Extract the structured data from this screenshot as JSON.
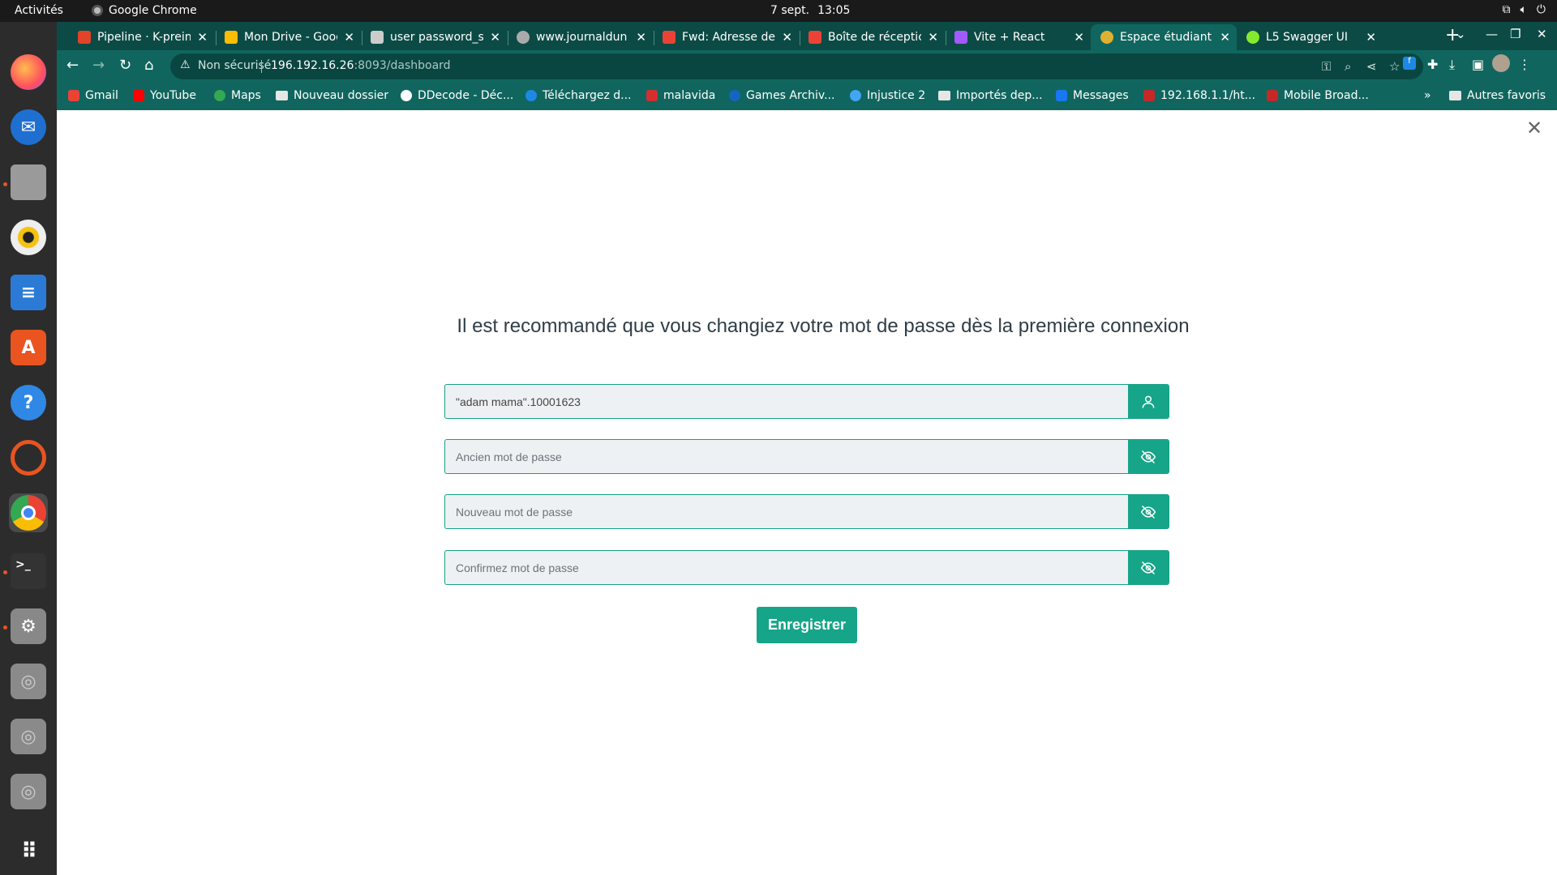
{
  "system": {
    "activities": "Activités",
    "app_name": "Google Chrome",
    "date": "7 sept.",
    "time": "13:05"
  },
  "tabs": [
    {
      "title": "Pipeline · K-prein",
      "icon": "gitlab-icon",
      "color": "#e24329"
    },
    {
      "title": "Mon Drive - Goog",
      "icon": "drive-icon",
      "color": "#fbbc04"
    },
    {
      "title": "user password_s",
      "icon": "doc-icon",
      "color": "#cccccc"
    },
    {
      "title": "www.journaldun",
      "icon": "globe-icon",
      "color": "#aaaaaa"
    },
    {
      "title": "Fwd: Adresse de",
      "icon": "gmail-icon",
      "color": "#ea4335"
    },
    {
      "title": "Boîte de réceptic",
      "icon": "gmail-icon",
      "color": "#ea4335"
    },
    {
      "title": "Vite + React",
      "icon": "vite-icon",
      "color": "#a259ff"
    },
    {
      "title": "Espace étudiant",
      "icon": "school-icon",
      "color": "#e0b030"
    },
    {
      "title": "L5 Swagger UI",
      "icon": "swagger-icon",
      "color": "#85ea2d"
    }
  ],
  "address": {
    "security": "Non sécurisé",
    "host": "196.192.16.26",
    "path": ":8093/dashboard"
  },
  "bookmarks": [
    {
      "label": "Gmail",
      "color": "#ea4335"
    },
    {
      "label": "YouTube",
      "color": "#ff0000"
    },
    {
      "label": "Maps",
      "color": "#34a853"
    },
    {
      "label": "Nouveau dossier",
      "color": "folder"
    },
    {
      "label": "DDecode - Déc...",
      "color": "#ffffff"
    },
    {
      "label": "Téléchargez d...",
      "color": "#1e88e5"
    },
    {
      "label": "malavida",
      "color": "#d32f2f"
    },
    {
      "label": "Games Archiv...",
      "color": "#1565c0"
    },
    {
      "label": "Injustice 2",
      "color": "#42a5f5"
    },
    {
      "label": "Importés dep...",
      "color": "folder"
    },
    {
      "label": "Messages",
      "color": "#1877f2"
    },
    {
      "label": "192.168.1.1/ht...",
      "color": "#c62828"
    },
    {
      "label": "Mobile Broad...",
      "color": "#c62828"
    }
  ],
  "bookmarks_more": "»",
  "other_bookmarks": "Autres favoris",
  "form": {
    "heading": "Il est recommandé que vous changiez votre mot de passe dès la première connexion",
    "username_value": "\"adam mama\".10001623",
    "old_password_placeholder": "Ancien mot de passe",
    "new_password_placeholder": "Nouveau mot de passe",
    "confirm_password_placeholder": "Confirmez mot de passe",
    "submit_label": "Enregistrer"
  },
  "colors": {
    "accent": "#17a589",
    "chrome_frame": "#10665e",
    "chrome_tabstrip": "#0c4b45"
  }
}
